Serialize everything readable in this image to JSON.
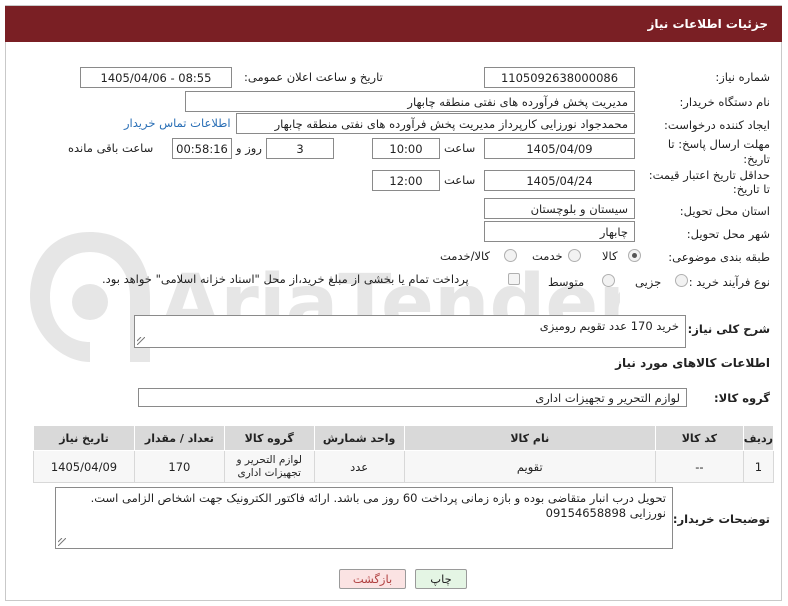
{
  "header": {
    "title": "جزئیات اطلاعات نیاز"
  },
  "form": {
    "need_number": {
      "label": "شماره نیاز:",
      "value": "1105092638000086"
    },
    "announce_datetime": {
      "label": "تاریخ و ساعت اعلان عمومی:",
      "value": "1405/04/06 - 08:55"
    },
    "buyer_org": {
      "label": "نام دستگاه خریدار:",
      "value": "مدیریت پخش فرآورده های نفتی منطقه چابهار"
    },
    "requester": {
      "label": "ایجاد کننده درخواست:",
      "value": "محمدجواد نورزایی کارپرداز مدیریت پخش فرآورده های نفتی منطقه چابهار",
      "contact_link": "اطلاعات تماس خریدار"
    },
    "reply_deadline": {
      "label_line1": "مهلت ارسال پاسخ: تا",
      "label_line2": "تاریخ:",
      "date": "1405/04/09",
      "time_label": "ساعت",
      "time": "10:00",
      "days": "3",
      "days_label": "روز و",
      "remaining": "00:58:16",
      "remaining_label": "ساعت باقی مانده"
    },
    "price_validity": {
      "label_line1": "حداقل تاریخ اعتبار قیمت:",
      "label_line2": "تا تاریخ:",
      "date": "1405/04/24",
      "time_label": "ساعت",
      "time": "12:00"
    },
    "province": {
      "label": "استان محل تحویل:",
      "value": "سیستان و بلوچستان"
    },
    "city": {
      "label": "شهر محل تحویل:",
      "value": "چابهار"
    },
    "category": {
      "label": "طبقه بندی موضوعی:",
      "options": [
        "کالا",
        "خدمت",
        "کالا/خدمت"
      ],
      "selected": "کالا"
    },
    "purchase_type": {
      "label": "نوع فرآیند خرید :",
      "options": [
        "جزیی",
        "متوسط"
      ],
      "selected": "",
      "payment_note": "پرداخت تمام یا بخشی از مبلغ خرید،از محل \"اسناد خزانه اسلامی\" خواهد بود."
    }
  },
  "description": {
    "label": "شرح کلی نیاز:",
    "value": "خرید 170 عدد تقویم رومیزی"
  },
  "goods_section": {
    "title": "اطلاعات کالاهای مورد نیاز",
    "group_label": "گروه کالا:",
    "group_value": "لوازم التحریر و تجهیزات اداری"
  },
  "table": {
    "headers": [
      "ردیف",
      "کد کالا",
      "نام کالا",
      "واحد شمارش",
      "گروه کالا",
      "تعداد / مقدار",
      "تاریخ نیاز"
    ],
    "rows": [
      {
        "row": "1",
        "code": "--",
        "name": "تقویم",
        "unit": "عدد",
        "group": "لوازم التحریر و تجهیزات اداری",
        "qty": "170",
        "date": "1405/04/09"
      }
    ]
  },
  "buyer_notes": {
    "label": "توضیحات خریدار:",
    "line1": "تحویل درب انبار متقاضی بوده و بازه زمانی پرداخت 60 روز می باشد. ارائه فاکتور الکترونیک جهت اشخاص الزامی است.",
    "line2": "نورزایی 09154658898"
  },
  "buttons": {
    "print": "چاپ",
    "back": "بازگشت"
  },
  "watermark": {
    "text": "AriaTender.net"
  },
  "colors": {
    "header_bg": "#7a1f24",
    "link": "#2a6fb6",
    "back_button_bg": "#fbe3e3",
    "print_button_bg": "#e4f5e4"
  }
}
